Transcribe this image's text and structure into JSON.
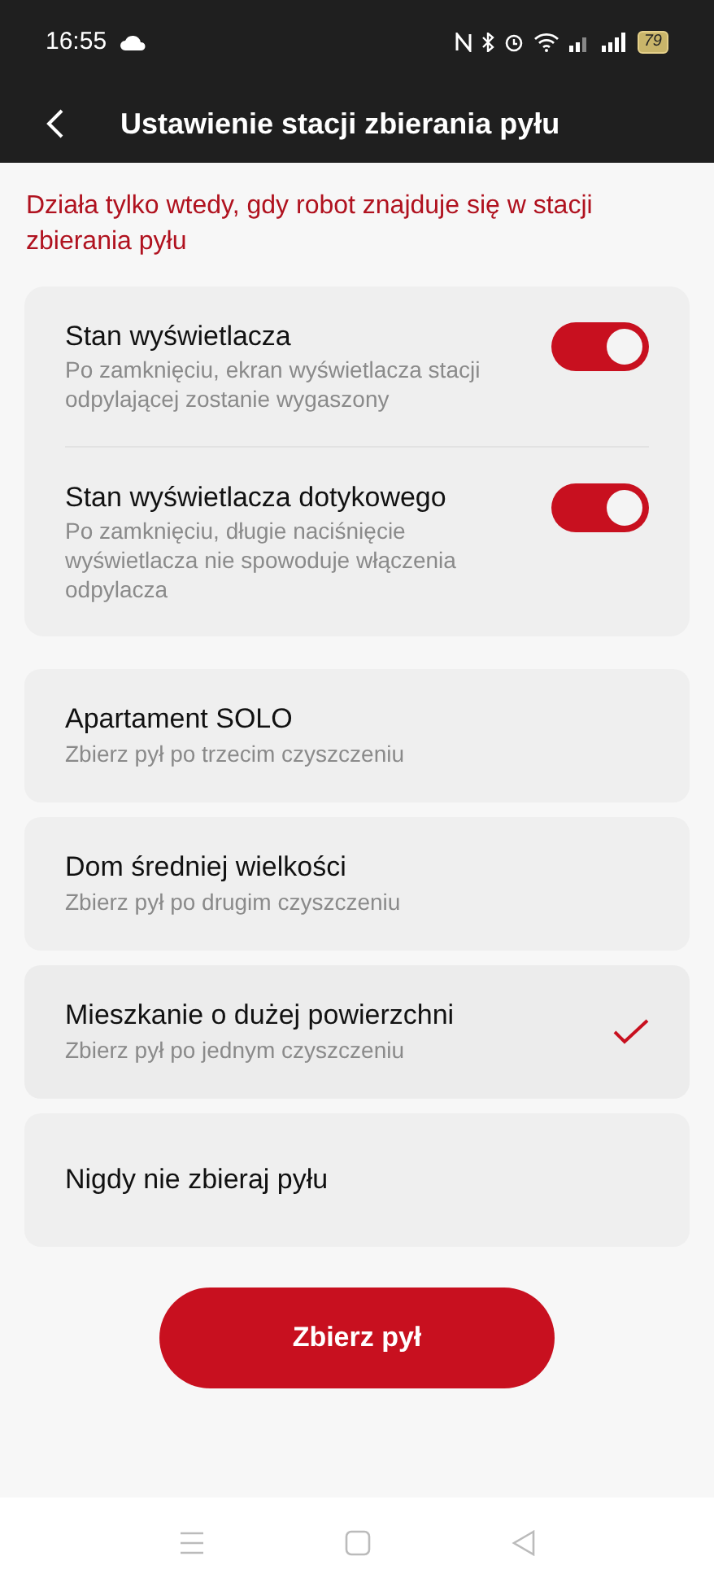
{
  "status_bar": {
    "time": "16:55",
    "battery": "79"
  },
  "header": {
    "title": "Ustawienie stacji zbierania pyłu"
  },
  "notice": "Działa tylko wtedy, gdy robot znajduje się w stacji zbierania pyłu",
  "toggles": [
    {
      "label": "Stan wyświetlacza",
      "description": "Po zamknięciu, ekran wyświetlacza stacji odpylającej zostanie wygaszony",
      "on": true
    },
    {
      "label": "Stan wyświetlacza dotykowego",
      "description": "Po zamknięciu, długie naciśnięcie wyświetlacza nie spowoduje włączenia odpylacza",
      "on": true
    }
  ],
  "modes": [
    {
      "label": "Apartament SOLO",
      "description": "Zbierz pył po trzecim czyszczeniu",
      "selected": false
    },
    {
      "label": "Dom średniej wielkości",
      "description": "Zbierz pył po drugim czyszczeniu",
      "selected": false
    },
    {
      "label": "Mieszkanie o dużej powierzchni",
      "description": "Zbierz pył po jednym czyszczeniu",
      "selected": true
    },
    {
      "label": "Nigdy nie zbieraj pyłu",
      "selected": false
    }
  ],
  "action_button": "Zbierz pył"
}
